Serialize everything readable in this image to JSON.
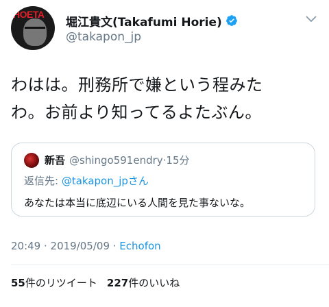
{
  "author": {
    "display_name": "堀江貴文(Takafumi Horie)",
    "handle": "@takapon_jp",
    "avatar_logo_text": "HOETA"
  },
  "tweet": {
    "text_line1": "わはは。刑務所で嫌という程みた",
    "text_line2": "わ。お前より知ってるよたぶん。"
  },
  "quote": {
    "name": "新吾",
    "handle_time": "@shingo591endry·15分",
    "reply_prefix": "返信先: ",
    "reply_link": "@takapon_jpさん",
    "text": "あなたは本当に底辺にいる人間を見た事ないな。"
  },
  "meta": {
    "time_date": "20:49 · 2019/05/09 · ",
    "via": "Echofon"
  },
  "stats": {
    "retweet_count": "55",
    "retweet_label": "件のリツイート",
    "like_count": "227",
    "like_label": "件のいいね"
  },
  "colors": {
    "accent": "#1b95e0",
    "secondary_text": "#657786",
    "border": "#ccd6dd"
  },
  "icons": {
    "verified": "verified-badge-icon",
    "caret": "chevron-down-icon"
  }
}
